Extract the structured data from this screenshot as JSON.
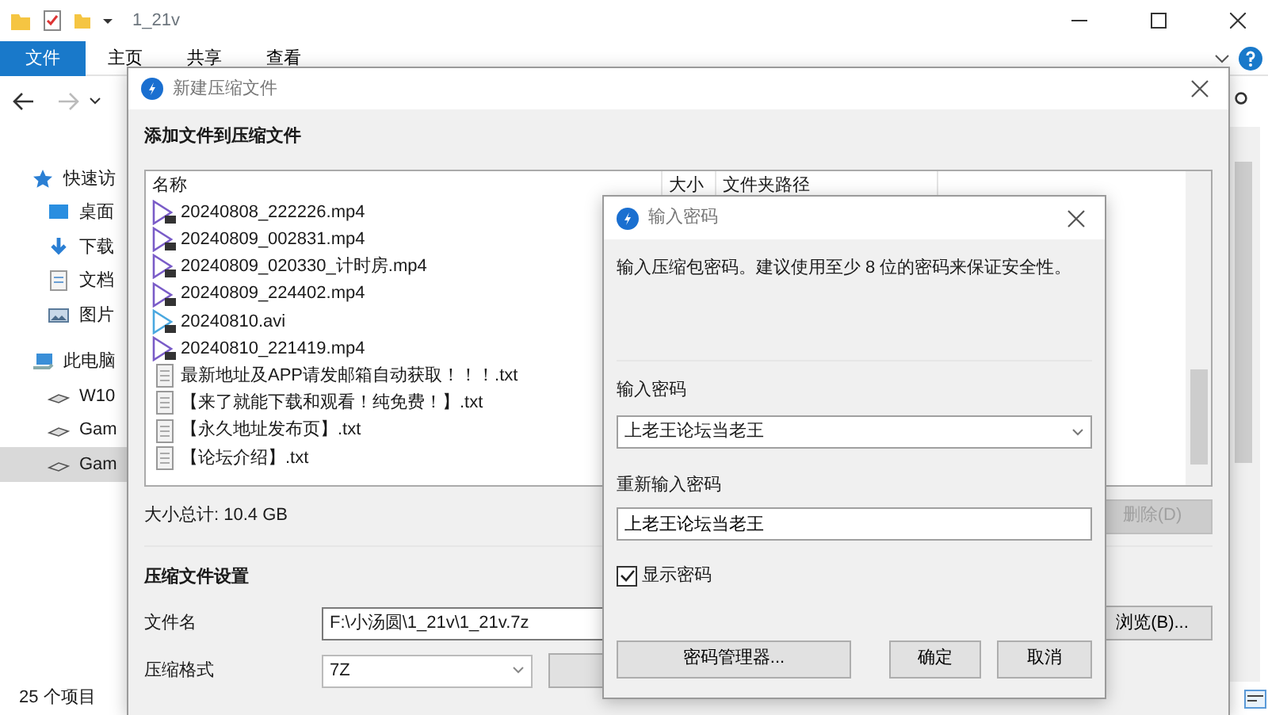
{
  "explorer": {
    "title": "1_21v",
    "ribbon_tabs": [
      {
        "label": "文件",
        "selected": true
      },
      {
        "label": "主页",
        "selected": false
      },
      {
        "label": "共享",
        "selected": false
      },
      {
        "label": "查看",
        "selected": false
      }
    ],
    "sidebar": {
      "items": [
        {
          "label": "快速访",
          "kind": "star",
          "selected": false
        },
        {
          "label": "桌面",
          "kind": "desktop",
          "selected": false
        },
        {
          "label": "下载",
          "kind": "download",
          "selected": false
        },
        {
          "label": "文档",
          "kind": "document",
          "selected": false
        },
        {
          "label": "图片",
          "kind": "pictures",
          "selected": false
        },
        {
          "label": "此电脑",
          "kind": "computer",
          "selected": false
        },
        {
          "label": "W10",
          "kind": "drive",
          "selected": false
        },
        {
          "label": "Gam",
          "kind": "drive",
          "selected": false
        },
        {
          "label": "Gam",
          "kind": "drive",
          "selected": true
        }
      ]
    },
    "status_bar": "25 个项目"
  },
  "compress_dialog": {
    "title": "新建压缩文件",
    "heading": "添加文件到压缩文件",
    "file_list": {
      "columns": [
        "名称",
        "大小",
        "文件夹路径"
      ],
      "rows": [
        {
          "name": "20240808_222226.mp4",
          "kind": "video",
          "color": "#7a5cc8"
        },
        {
          "name": "20240809_002831.mp4",
          "kind": "video",
          "color": "#7a5cc8"
        },
        {
          "name": "20240809_020330_计时房.mp4",
          "kind": "video",
          "color": "#7a5cc8"
        },
        {
          "name": "20240809_224402.mp4",
          "kind": "video",
          "color": "#7a5cc8"
        },
        {
          "name": "20240810.avi",
          "kind": "video",
          "color": "#4aa8e0"
        },
        {
          "name": "20240810_221419.mp4",
          "kind": "video",
          "color": "#7a5cc8"
        },
        {
          "name": "最新地址及APP请发邮箱自动获取！！！.txt",
          "kind": "text"
        },
        {
          "name": "【来了就能下载和观看！纯免费！】.txt",
          "kind": "text"
        },
        {
          "name": "【永久地址发布页】.txt",
          "kind": "text"
        },
        {
          "name": "【论坛介绍】.txt",
          "kind": "text"
        }
      ]
    },
    "total": "大小总计: 10.4 GB",
    "delete_button": {
      "label": "删除(D)",
      "disabled": true
    },
    "settings_heading": "压缩文件设置",
    "filename_label": "文件名",
    "filename": "F:\\小汤圆\\1_21v\\1_21v.7z",
    "browse_button": "浏览(B)...",
    "format_label": "压缩格式",
    "format": "7Z"
  },
  "password_dialog": {
    "title": "输入密码",
    "description": "输入压缩包密码。建议使用至少 8 位的密码来保证安全性。",
    "password_label": "输入密码",
    "password": "上老王论坛当老王",
    "confirm_label": "重新输入密码",
    "confirm": "上老王论坛当老王",
    "show_password": {
      "label": "显示密码",
      "checked": true
    },
    "buttons": [
      "密码管理器...",
      "确定",
      "取消"
    ]
  }
}
